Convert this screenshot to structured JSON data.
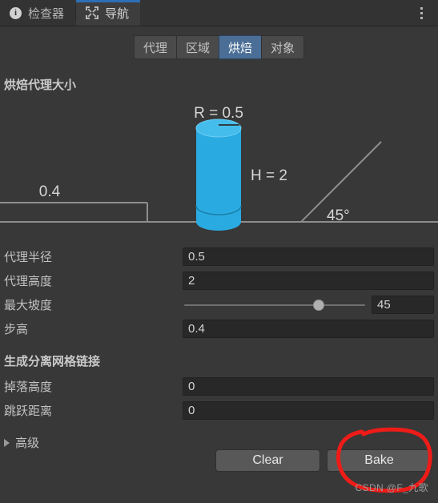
{
  "window": {
    "tabs": [
      {
        "label": "检查器",
        "icon": "info-icon",
        "active": false
      },
      {
        "label": "导航",
        "icon": "navigation-move-icon",
        "active": true
      }
    ],
    "overflow_menu_icon": "kebab-menu-icon"
  },
  "subtabs": {
    "items": [
      {
        "label": "代理"
      },
      {
        "label": "区域"
      },
      {
        "label": "烘焙"
      },
      {
        "label": "对象"
      }
    ],
    "selected": "烘焙",
    "selected_color": "#4a6e96"
  },
  "sections": {
    "agent_size": {
      "title": "烘焙代理大小",
      "rows": [
        {
          "label": "代理半径",
          "value": "0.5",
          "type": "text"
        },
        {
          "label": "代理高度",
          "value": "2",
          "type": "text"
        },
        {
          "label": "最大坡度",
          "value": "45",
          "type": "slider",
          "slider_percent": 74
        },
        {
          "label": "步高",
          "value": "0.4",
          "type": "text"
        }
      ]
    },
    "offmesh": {
      "title": "生成分离网格链接",
      "rows": [
        {
          "label": "掉落高度",
          "value": "0",
          "type": "text"
        },
        {
          "label": "跳跃距离",
          "value": "0",
          "type": "text"
        }
      ]
    },
    "advanced": {
      "label": "高级",
      "expanded": false,
      "icon": "triangle-right-icon"
    }
  },
  "diagram": {
    "name": "agent-size-diagram",
    "cylinder_color": "#29abe2",
    "cylinder_top_color": "#45bdec",
    "line_color": "#8e8e8e",
    "labels": {
      "radius": "R = 0.5",
      "height": "H = 2",
      "step": "0.4",
      "slope": "45°"
    }
  },
  "buttons": {
    "clear": "Clear",
    "bake": "Bake"
  },
  "annotation": {
    "shape": "hand-drawn-circle",
    "color": "#ee1c18",
    "target": "Bake"
  },
  "watermark": "CSDN @F_九歌"
}
